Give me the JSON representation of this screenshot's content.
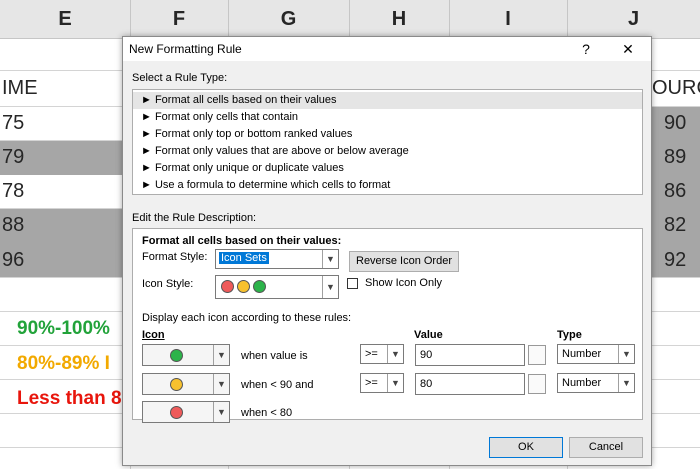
{
  "sheet": {
    "columns": [
      "E",
      "F",
      "G",
      "H",
      "I",
      "J"
    ],
    "left_header": "IME",
    "right_header": "OURC",
    "left_values": [
      "75",
      "79",
      "78",
      "88",
      "96"
    ],
    "right_values": [
      "90",
      "89",
      "86",
      "82",
      "92"
    ],
    "legend": [
      {
        "text": "90%-100%",
        "color": "#22a33a"
      },
      {
        "text": "80%-89% I",
        "color": "#f2a900"
      },
      {
        "text": "Less than 8",
        "color": "#e8150c"
      }
    ]
  },
  "dialog": {
    "title": "New Formatting Rule",
    "help": "?",
    "close": "✕",
    "select_rule_label": "Select a Rule Type:",
    "rule_types": [
      "► Format all cells based on their values",
      "► Format only cells that contain",
      "► Format only top or bottom ranked values",
      "► Format only values that are above or below average",
      "► Format only unique or duplicate values",
      "► Use a formula to determine which cells to format"
    ],
    "edit_label": "Edit the Rule Description:",
    "format_all_heading": "Format all cells based on their values:",
    "format_style_label": "Format Style:",
    "format_style_value": "Icon Sets",
    "reverse_button": "Reverse Icon Order",
    "icon_style_label": "Icon Style:",
    "show_icon_only_label": "Show Icon Only",
    "display_rules_label": "Display each icon according to these rules:",
    "headers": {
      "icon": "Icon",
      "value": "Value",
      "type": "Type"
    },
    "icon_rules": [
      {
        "icon_color": "#2cb34a",
        "condition": "when value is",
        "operator": ">=",
        "value": "90",
        "type": "Number"
      },
      {
        "icon_color": "#f7c12e",
        "condition": "when < 90 and",
        "operator": ">=",
        "value": "80",
        "type": "Number"
      },
      {
        "icon_color": "#ee5a5a",
        "condition": "when < 80",
        "operator": "",
        "value": "",
        "type": ""
      }
    ],
    "ok": "OK",
    "cancel": "Cancel"
  },
  "icons": {
    "red": "#ee5a5a",
    "yellow": "#f7c12e",
    "green": "#2cb34a"
  }
}
